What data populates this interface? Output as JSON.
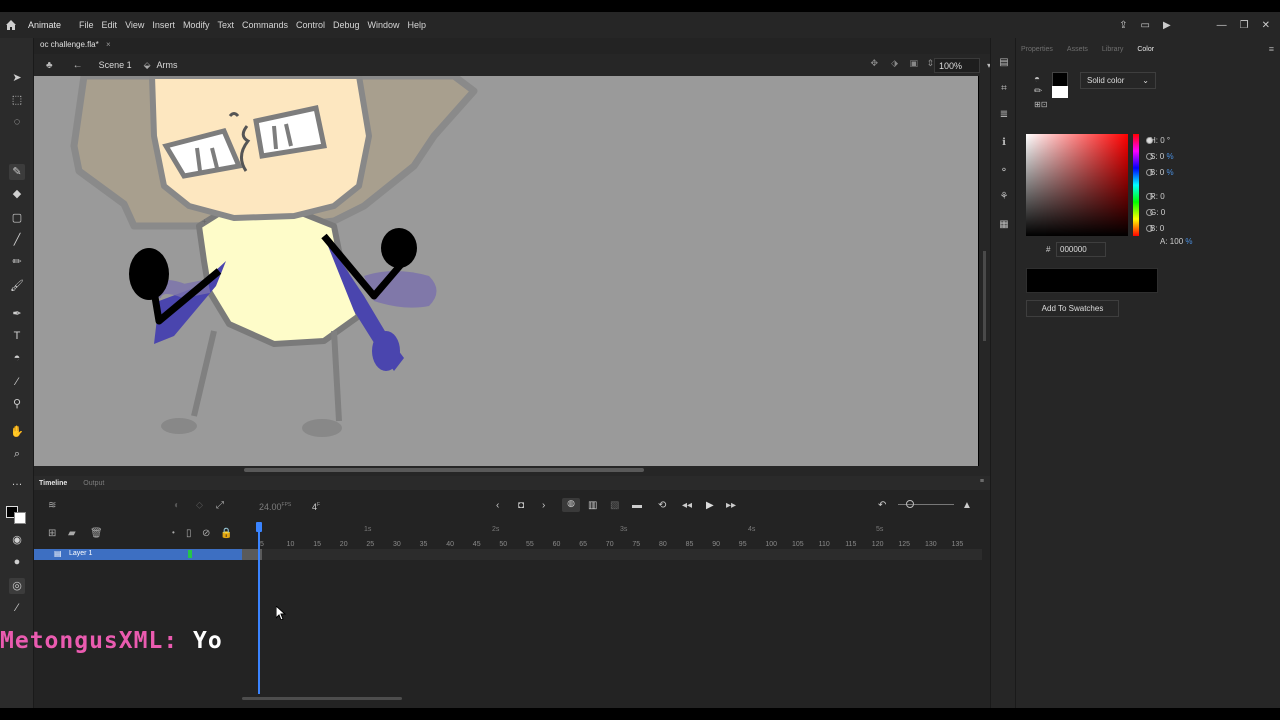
{
  "app": {
    "name": "Animate"
  },
  "menu": [
    "File",
    "Edit",
    "View",
    "Insert",
    "Modify",
    "Text",
    "Commands",
    "Control",
    "Debug",
    "Window",
    "Help"
  ],
  "document": {
    "tab_title": "oc challenge.fla*",
    "close_glyph": "×"
  },
  "edit_bar": {
    "scene": "Scene 1",
    "symbol": "Arms",
    "zoom": "100%"
  },
  "timeline": {
    "tabs": [
      "Timeline",
      "Output"
    ],
    "fps_value": "24.00",
    "fps_unit": "FPS",
    "current_frame": "4",
    "frame_suffix": "F",
    "frame_ticks": [
      "5",
      "10",
      "15",
      "20",
      "25",
      "30",
      "35",
      "40",
      "45",
      "50",
      "55",
      "60",
      "65",
      "70",
      "75",
      "80",
      "85",
      "90",
      "95",
      "100",
      "105",
      "110",
      "115",
      "120",
      "125",
      "130",
      "135"
    ],
    "second_markers": [
      "1s",
      "2s",
      "3s",
      "4s",
      "5s"
    ],
    "layers": [
      {
        "name": "Layer 1",
        "color": "#25c64a"
      }
    ]
  },
  "color_panel": {
    "tabs": [
      "Properties",
      "Assets",
      "Library",
      "Color"
    ],
    "active_tab": "Color",
    "fill_type": "Solid color",
    "hsb": {
      "h_label": "H:",
      "h": "0",
      "h_unit": "°",
      "s_label": "S:",
      "s": "0",
      "s_unit": "%",
      "b_label": "B:",
      "b": "0",
      "b_unit": "%"
    },
    "rgb": {
      "r_label": "R:",
      "r": "0",
      "g_label": "G:",
      "g": "0",
      "b_label": "B:",
      "b": "0"
    },
    "alpha": {
      "label": "A:",
      "value": "100",
      "unit": "%"
    },
    "hex_prefix": "#",
    "hex": "000000",
    "add_button": "Add To Swatches"
  },
  "caption": {
    "name": "MetongusXML:",
    "text": "Yo"
  },
  "colors": {
    "accent": "#3a84ff",
    "layer_selected": "#3d6fc2",
    "stage": "#9a9a9a",
    "caption_name": "#ea5bb0"
  }
}
